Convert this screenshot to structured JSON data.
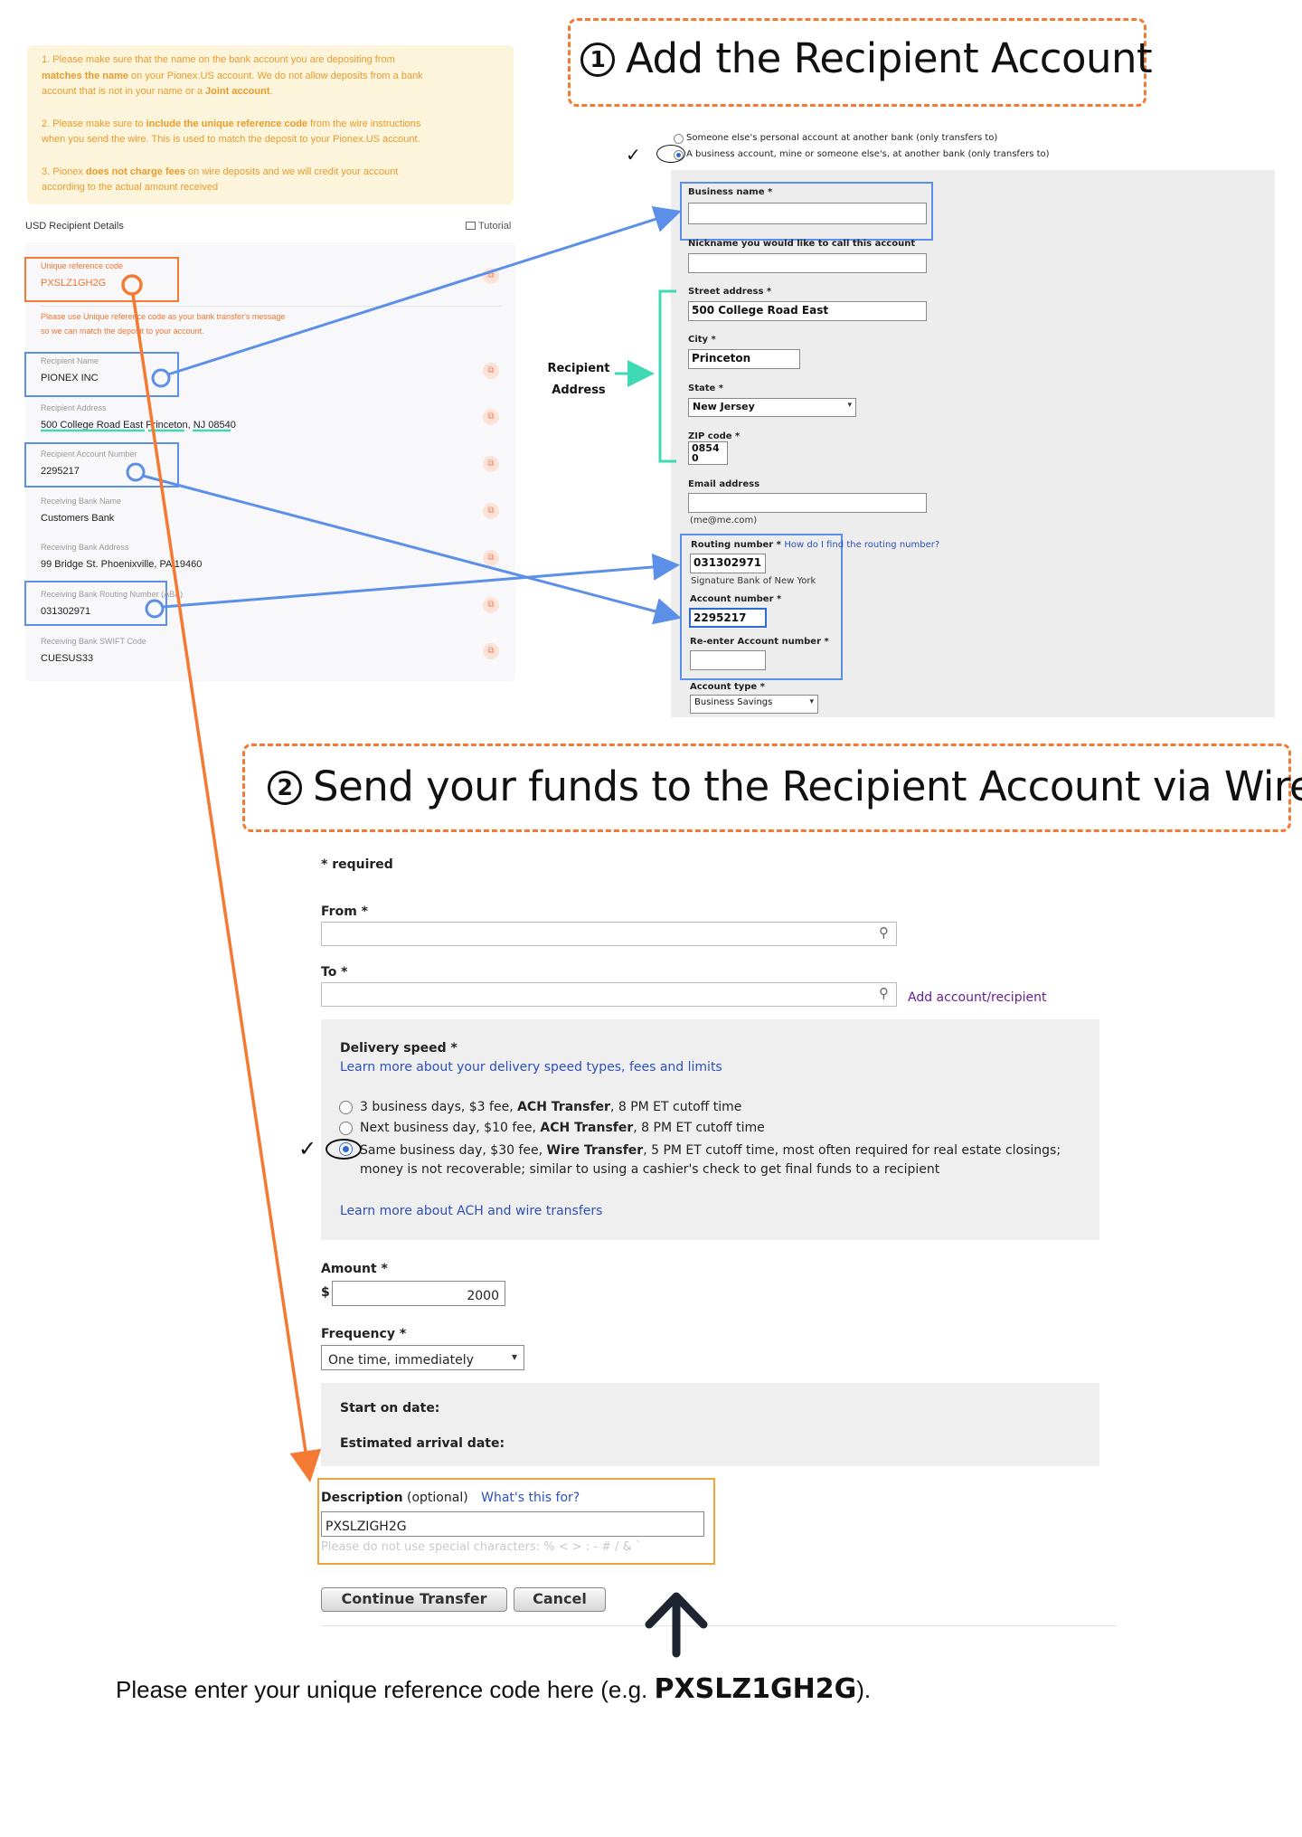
{
  "colors": {
    "orange": "#f47a33",
    "blue": "#5b8fe8",
    "teal": "#3fd9b4",
    "link": "#2d4fb8"
  },
  "notice": {
    "p1_a": "1. Please make sure that the name on the bank account you are depositing from",
    "p1_b_bold": "matches the name",
    "p1_b": " on your Pionex.US account. We do not allow deposits from a bank",
    "p1_c": "account that is not in your name or a ",
    "p1_c_bold": "Joint account",
    "p1_c_end": ".",
    "p2_a": "2. Please make sure to ",
    "p2_a_bold": "include the unique reference code",
    "p2_a_end": " from the wire instructions",
    "p2_b": "when you send the wire. This is used to match the deposit to your Pionex.US account.",
    "p3_a": "3. Pionex ",
    "p3_a_bold": "does not charge fees",
    "p3_a_end": " on wire deposits and we will credit your account",
    "p3_b": "according to the actual amount received"
  },
  "details": {
    "title": "USD Recipient Details",
    "tutorial": "Tutorial",
    "reference_label": "Unique reference code",
    "reference_value": "PXSLZ1GH2G",
    "reference_note_1": "Please use Unique reference code as your bank transfer's message",
    "reference_note_2": "so we can match the deposit to your account.",
    "fields": [
      {
        "label": "Recipient Name",
        "value": "PIONEX INC"
      },
      {
        "label": "Recipient Address",
        "value": "500 College Road East Princeton, NJ 08540"
      },
      {
        "label": "Recipient Account Number",
        "value": "2295217"
      },
      {
        "label": "Receiving Bank Name",
        "value": "Customers Bank"
      },
      {
        "label": "Receiving Bank Address",
        "value": "99 Bridge St. Phoenixville, PA 19460"
      },
      {
        "label": "Receiving Bank Routing Number (ABA)",
        "value": "031302971"
      },
      {
        "label": "Receiving Bank SWIFT Code",
        "value": "CUESUS33"
      }
    ]
  },
  "step1": {
    "number": "1",
    "title": "Add the Recipient Account",
    "option_personal": "Someone else's personal account at another bank (only transfers to)",
    "option_business": "A business account, mine or someone else's, at another bank (only transfers to)",
    "checkmark": "✓",
    "recipient_address_callout_1": "Recipient",
    "recipient_address_callout_2": "Address",
    "form": {
      "business_name_label": "Business name *",
      "business_name_value": "",
      "nickname_label": "Nickname you would like to call this account",
      "nickname_value": "",
      "street_label": "Street address *",
      "street_value": "500 College Road East",
      "city_label": "City *",
      "city_value": "Princeton",
      "state_label": "State *",
      "state_value": "New Jersey",
      "zip_label": "ZIP code *",
      "zip_value_1": "0854",
      "zip_value_2": "0",
      "email_label": "Email address",
      "email_value": "",
      "email_hint": "(me@me.com)",
      "routing_label": "Routing number *",
      "routing_help": "How do I find the routing number?",
      "routing_value": "031302971",
      "routing_bank": "Signature Bank of New York",
      "account_label": "Account number *",
      "account_value": "2295217",
      "reenter_label": "Re-enter Account number *",
      "reenter_value": "",
      "account_type_label": "Account type *",
      "account_type_value": "Business Savings"
    }
  },
  "step2": {
    "number": "2",
    "title": "Send your funds to the Recipient Account via Wire",
    "required_note": "* required",
    "from_label": "From *",
    "from_value": "",
    "to_label": "To *",
    "to_value": "",
    "add_recipient": "Add account/recipient",
    "delivery_label": "Delivery speed *",
    "delivery_link": "Learn more about your delivery speed types, fees and limits",
    "options": [
      {
        "pre": "3 business days, $3 fee, ",
        "bold": "ACH Transfer",
        "post": ", 8 PM ET cutoff time"
      },
      {
        "pre": "Next business day, $10 fee, ",
        "bold": "ACH Transfer",
        "post": ", 8 PM ET cutoff time"
      },
      {
        "pre": "Same business day, $30 fee, ",
        "bold": "Wire Transfer",
        "post": ", 5 PM ET cutoff time, most often required for real estate closings;",
        "line2": "money is not recoverable; similar to using a cashier's check to get final funds to a recipient"
      }
    ],
    "checkmark": "✓",
    "learn_more": "Learn more about ACH and wire transfers",
    "amount_label": "Amount *",
    "currency": "$",
    "amount_value": "2000",
    "frequency_label": "Frequency *",
    "frequency_value": "One time, immediately",
    "start_label": "Start on date:",
    "arrival_label": "Estimated arrival date:",
    "description_label": "Description",
    "description_optional": "(optional)",
    "description_help": "What's this for?",
    "description_value": "PXSLZIGH2G",
    "description_hint": "Please do not use special characters: % < > : - # / & `",
    "continue_button": "Continue Transfer",
    "cancel_button": "Cancel"
  },
  "footer": {
    "text_before": "Please enter your unique reference code here (e.g. ",
    "code": "PXSLZ1GH2G",
    "text_after": ")."
  }
}
